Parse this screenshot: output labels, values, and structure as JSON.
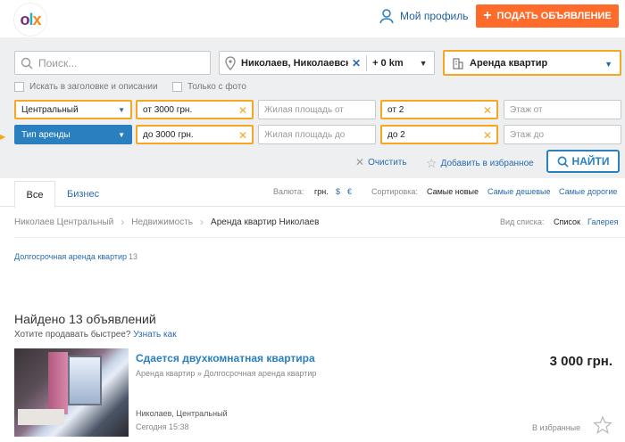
{
  "header": {
    "logo": "OLX",
    "profile_label": "Мой профиль",
    "post_button": "ПОДАТЬ ОБЪЯВЛЕНИЕ"
  },
  "search": {
    "query_placeholder": "Поиск...",
    "location": "Николаев, Николаевская обл.",
    "radius": "+ 0 km",
    "category": "Аренда квартир",
    "check_title_desc": "Искать в заголовке и описании",
    "check_photo": "Только с фото"
  },
  "filters": {
    "district": "Центральный",
    "rent_type": "Тип аренды",
    "price_from": "от 3000 грн.",
    "price_to": "до 3000 грн.",
    "area_from_placeholder": "Жилая площадь от",
    "area_to_placeholder": "Жилая площадь до",
    "rooms_from": "от 2",
    "rooms_to": "до 2",
    "floor_from_placeholder": "Этаж от",
    "floor_to_placeholder": "Этаж до",
    "clear_label": "Очистить",
    "favorite_label": "Добавить в избранное",
    "find_button": "НАЙТИ"
  },
  "tabs": {
    "all": "Все",
    "business": "Бизнес",
    "currency_label": "Валюта:",
    "currency_uah": "грн.",
    "currency_usd": "$",
    "currency_eur": "€",
    "sort_label": "Сортировка:",
    "sort_new": "Самые новые",
    "sort_cheap": "Самые дешевые",
    "sort_expensive": "Самые дорогие"
  },
  "breadcrumbs": {
    "items": [
      "Николаев Центральный",
      "Недвижимость",
      "Аренда квартир Николаев"
    ]
  },
  "view": {
    "label": "Вид списка:",
    "list": "Список",
    "gallery": "Галерея"
  },
  "subcategory": {
    "label": "Долгосрочная аренда квартир",
    "count": "13"
  },
  "results": {
    "found": "Найдено 13 объявлений",
    "sell_faster": "Хотите продавать быстрее?",
    "learn_how": "Узнать как"
  },
  "listing": {
    "title": "Сдается двухкомнатная квартира",
    "category": "Аренда квартир » Долгосрочная аренда квартир",
    "price": "3 000 грн.",
    "location": "Николаев, Центральный",
    "time": "Сегодня 15:38",
    "favorite": "В избранные"
  },
  "colors": {
    "accent_orange": "#ff6b2b",
    "highlight": "#f5a623",
    "link_blue": "#2a7fbf"
  }
}
